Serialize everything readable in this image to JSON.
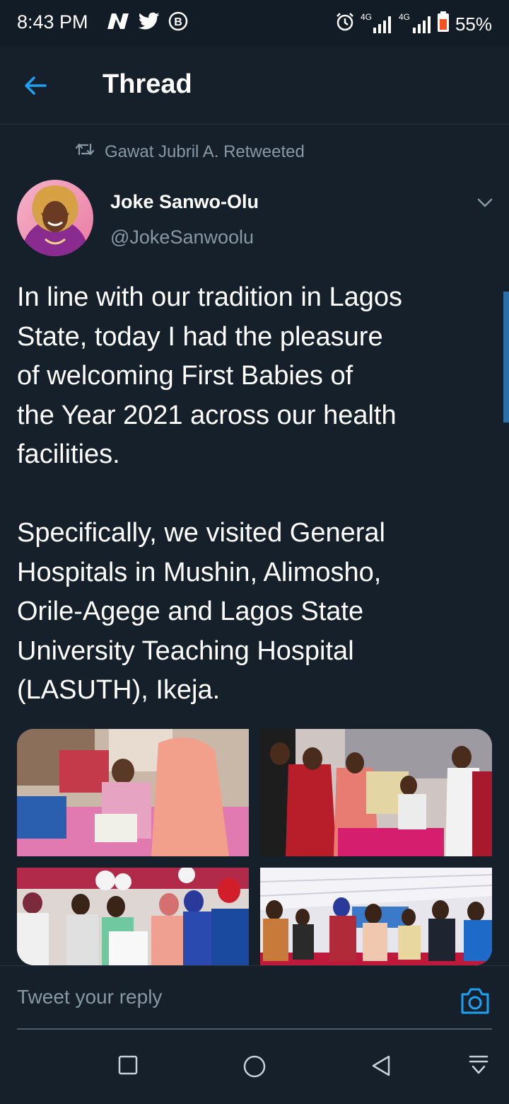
{
  "status_bar": {
    "time": "8:43 PM",
    "left_icons": [
      "n-app-icon",
      "twitter-icon",
      "b-circle-icon"
    ],
    "right_icons": [
      "alarm-icon",
      "signal-4g-icon",
      "signal-4g-lte-icon",
      "battery-icon"
    ],
    "network1": "4G",
    "network2": "4G",
    "battery": "55%",
    "battery_color": "#f4511e"
  },
  "header": {
    "title": "Thread",
    "back_icon": "back-arrow-icon",
    "accent": "#1da1f2"
  },
  "tweet": {
    "retweet_label": "Gawat Jubril A. Retweeted",
    "author_name": "Joke Sanwo-Olu",
    "author_handle": "@JokeSanwoolu",
    "text": "In line with our tradition in Lagos\nState, today I had the pleasure\nof welcoming First Babies of\nthe Year 2021 across our health\nfacilities.\n\nSpecifically, we visited General\nHospitals in Mushin, Alimosho,\nOrile-Agege and Lagos State\nUniversity Teaching Hospital\n(LASUTH), Ikeja.",
    "photos": [
      "photo-1",
      "photo-2",
      "photo-3",
      "photo-4"
    ]
  },
  "reply": {
    "placeholder": "Tweet your reply",
    "camera_icon": "camera-icon"
  },
  "nav": {
    "icons": [
      "recents-square-icon",
      "home-circle-icon",
      "back-triangle-icon",
      "notification-shade-icon"
    ]
  },
  "colors": {
    "background": "#15202b",
    "secondary_text": "#8899a6",
    "divider": "#253341"
  }
}
